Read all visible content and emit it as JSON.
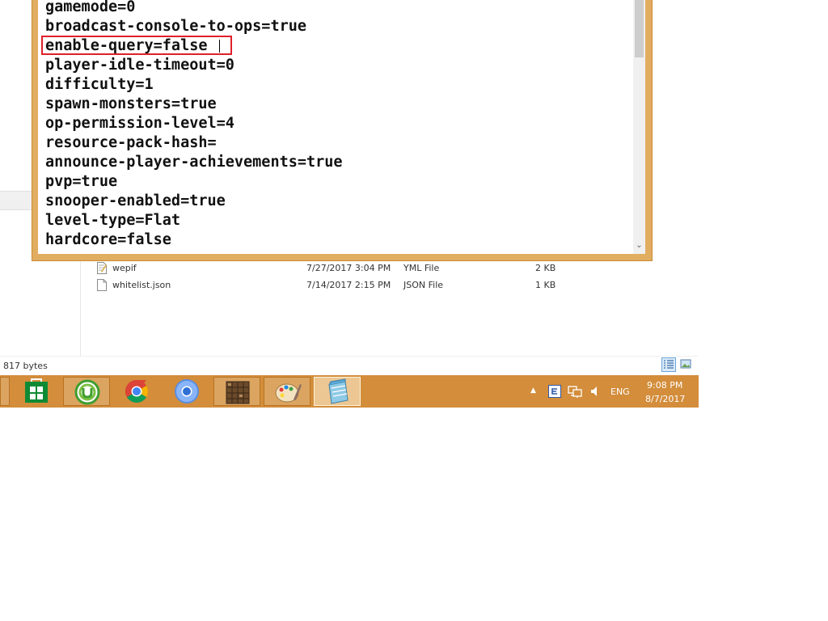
{
  "notepad": {
    "lines": [
      "gamemode=0",
      "broadcast-console-to-ops=true",
      "enable-query=false",
      "player-idle-timeout=0",
      "difficulty=1",
      "spawn-monsters=true",
      "op-permission-level=4",
      "resource-pack-hash=",
      "announce-player-achievements=true",
      "pvp=true",
      "snooper-enabled=true",
      "level-type=Flat",
      "hardcore=false"
    ],
    "scroll_down_glyph": "⌄"
  },
  "explorer": {
    "files": [
      {
        "name": "wepif",
        "date": "7/27/2017 3:04 PM",
        "type": "YML File",
        "size": "2 KB"
      },
      {
        "name": "whitelist.json",
        "date": "7/14/2017 2:15 PM",
        "type": "JSON File",
        "size": "1 KB"
      }
    ],
    "status": "817 bytes"
  },
  "taskbar": {
    "apps": [
      "store-icon",
      "utorrent-icon",
      "chrome-icon",
      "chromium-icon",
      "minecraft-icon",
      "paint-icon",
      "notepad-icon"
    ],
    "tray": {
      "language": "ENG",
      "time": "9:08 PM",
      "date": "8/7/2017",
      "show_hidden_glyph": "▲"
    }
  },
  "colors": {
    "taskbar": "#d38d3b",
    "window_frame": "#e1ad60",
    "highlight": "#e0202a"
  }
}
